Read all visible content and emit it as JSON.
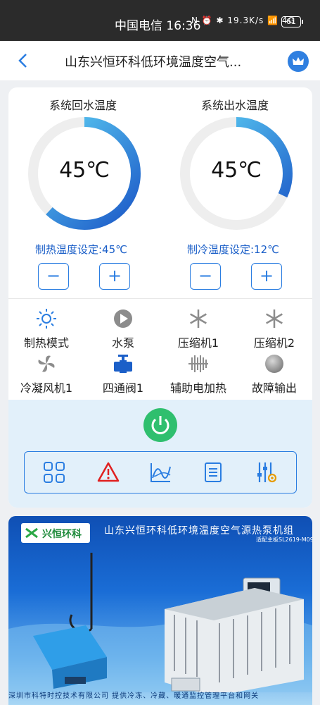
{
  "status_bar": {
    "time_label": "中国电信 16:36",
    "icons_text": "N ⏰ ✱ 19.3K/s 📶 4G",
    "battery": "61"
  },
  "navbar": {
    "title": "山东兴恒环科低环境温度空气..."
  },
  "gauges": [
    {
      "title": "系统回水温度",
      "value": "45℃",
      "level": 0.62,
      "set_label": "制热温度设定:45℃"
    },
    {
      "title": "系统出水温度",
      "value": "45℃",
      "level": 0.32,
      "set_label": "制冷温度设定:12℃"
    }
  ],
  "buttons": {
    "minus": "−",
    "plus": "+"
  },
  "status_items": [
    {
      "label": "制热模式",
      "icon": "sun-icon"
    },
    {
      "label": "水泵",
      "icon": "pump-icon"
    },
    {
      "label": "压缩机1",
      "icon": "snowflake-icon"
    },
    {
      "label": "压缩机2",
      "icon": "snowflake-icon"
    },
    {
      "label": "冷凝风机1",
      "icon": "fan-icon"
    },
    {
      "label": "四通阀1",
      "icon": "valve-icon"
    },
    {
      "label": "辅助电加热",
      "icon": "heater-icon"
    },
    {
      "label": "故障输出",
      "icon": "fault-dot-icon"
    }
  ],
  "toolbar": [
    "grid-icon",
    "warning-icon",
    "chart-icon",
    "list-icon",
    "settings-icon"
  ],
  "banner": {
    "logo_text": "兴恒环科",
    "title": "山东兴恒环科低环境温度空气源热泵机组",
    "subtitle": "适配主板SL2619-M09",
    "footer": "深圳市科特时控技术有限公司    提供冷冻、冷藏、暖通监控管理平台和网关"
  },
  "colors": {
    "accent": "#2a7de1",
    "power": "#2fbf6e",
    "warning": "#e02020"
  }
}
